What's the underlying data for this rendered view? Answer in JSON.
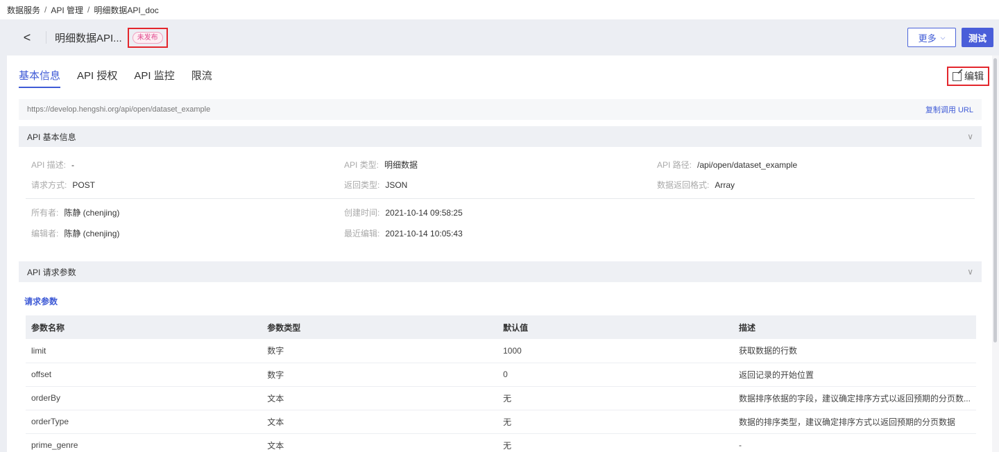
{
  "breadcrumb": {
    "items": [
      "数据服务",
      "API 管理",
      "明细数据API_doc"
    ],
    "sep": "/"
  },
  "header": {
    "back_icon": "chevron-left-icon",
    "back_glyph": "<",
    "title": "明细数据API...",
    "status": "未发布",
    "more_label": "更多",
    "more_glyph": "⌵",
    "test_label": "测试"
  },
  "tabs": [
    "基本信息",
    "API 授权",
    "API 监控",
    "限流"
  ],
  "edit_label": "编辑",
  "url": {
    "value": "https://develop.hengshi.org/api/open/dataset_example",
    "copy_label": "复制调用 URL"
  },
  "sections": {
    "basic": "API 基本信息",
    "request": "API 请求参数",
    "chevron": "∨"
  },
  "basic_info": {
    "row1": [
      {
        "label": "API 描述:",
        "value": "-"
      },
      {
        "label": "API 类型:",
        "value": "明细数据"
      },
      {
        "label": "API 路径:",
        "value": "/api/open/dataset_example"
      }
    ],
    "row2": [
      {
        "label": "请求方式:",
        "value": "POST"
      },
      {
        "label": "返回类型:",
        "value": "JSON"
      },
      {
        "label": "数据返回格式:",
        "value": "Array"
      }
    ],
    "row3": [
      {
        "label": "所有者:",
        "value": "陈静 (chenjing)"
      },
      {
        "label": "创建时间:",
        "value": "2021-10-14 09:58:25"
      }
    ],
    "row4": [
      {
        "label": "编辑者:",
        "value": "陈静 (chenjing)"
      },
      {
        "label": "最近编辑:",
        "value": "2021-10-14 10:05:43"
      }
    ]
  },
  "params": {
    "title": "请求参数",
    "columns": [
      "参数名称",
      "参数类型",
      "默认值",
      "描述"
    ],
    "rows": [
      [
        "limit",
        "数字",
        "1000",
        "获取数据的行数"
      ],
      [
        "offset",
        "数字",
        "0",
        "返回记录的开始位置"
      ],
      [
        "orderBy",
        "文本",
        "无",
        "数据排序依据的字段，建议确定排序方式以返回预期的分页数..."
      ],
      [
        "orderType",
        "文本",
        "无",
        "数据的排序类型，建议确定排序方式以返回预期的分页数据"
      ],
      [
        "prime_genre",
        "文本",
        "无",
        "-"
      ]
    ]
  },
  "colors": {
    "accent": "#3f5bd6",
    "highlight_border": "#e3262c",
    "badge_text": "#e0468d"
  }
}
